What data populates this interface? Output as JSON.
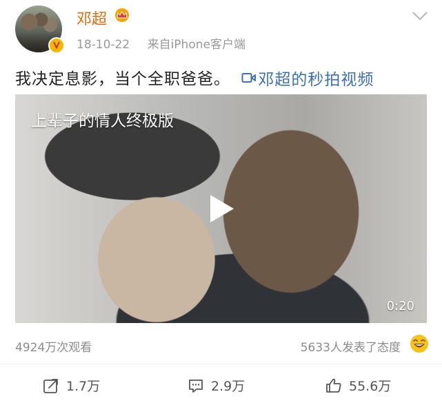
{
  "user": {
    "name": "邓超",
    "time": "18-10-22",
    "source": "来自iPhone客户端"
  },
  "post": {
    "text": "我决定息影，当个全职爸爸。",
    "video_link": "邓超的秒拍视频"
  },
  "video": {
    "title": "上辈子的情人终极版",
    "duration": "0:20"
  },
  "stats": {
    "views": "4924万次观看",
    "attitude": "5633人发表了态度"
  },
  "actions": {
    "repost": "1.7万",
    "comment": "2.9万",
    "like": "55.6万"
  },
  "colors": {
    "username": "#e76a12",
    "link": "#3a70b4",
    "verified": "#f7b500",
    "meta": "#999999"
  }
}
